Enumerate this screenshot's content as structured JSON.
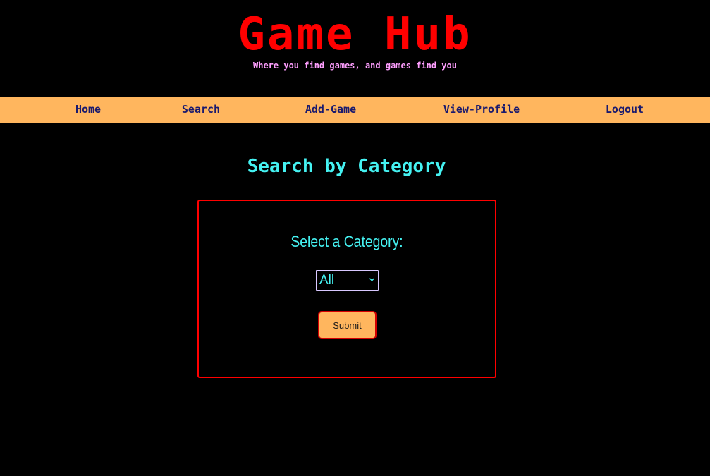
{
  "header": {
    "title": "Game Hub",
    "tagline": "Where you find games, and games find you"
  },
  "nav": {
    "home": "Home",
    "search": "Search",
    "add_game": "Add-Game",
    "view_profile": "View-Profile",
    "logout": "Logout"
  },
  "main": {
    "heading": "Search by Category",
    "form": {
      "label": "Select a Category:",
      "select": {
        "selected": "All",
        "icon": "chevron-down-icon"
      },
      "submit_label": "Submit"
    }
  },
  "colors": {
    "background": "#000000",
    "title": "#ff0000",
    "tagline": "#ff9fff",
    "nav_bar": "#ffb65e",
    "nav_text": "#1a1a6e",
    "accent_cyan": "#45f2f2",
    "panel_border": "#ff0000",
    "button": "#ffb65e"
  }
}
